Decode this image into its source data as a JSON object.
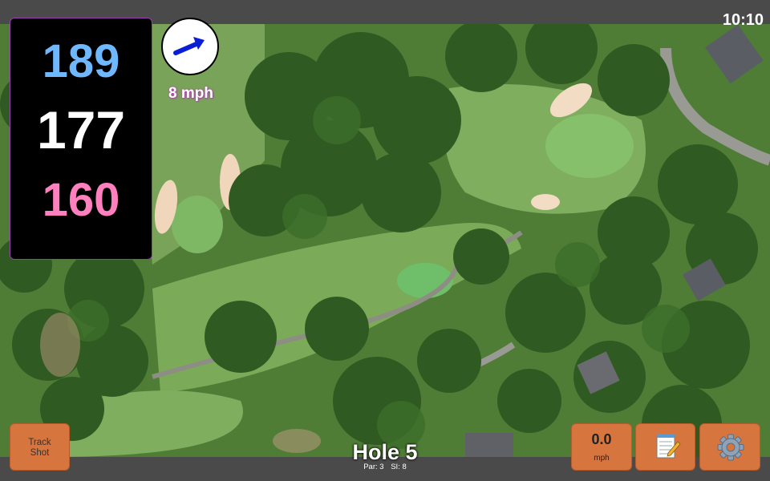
{
  "status": {
    "time": "10:10"
  },
  "yardages": {
    "back": "189",
    "center": "177",
    "front": "160"
  },
  "wind": {
    "speed_label": "8 mph",
    "icon": "arrow-right-icon"
  },
  "hole": {
    "title": "Hole 5",
    "par": "Par: 3",
    "si": "SI: 8"
  },
  "buttons": {
    "track_shot": [
      "Track",
      "Shot"
    ],
    "speed_value": "0.0",
    "speed_unit": "mph",
    "notes_icon": "notepad-icon",
    "settings_icon": "gear-icon"
  },
  "colors": {
    "back_yardage": "#6fb7ff",
    "center_yardage": "#ffffff",
    "front_yardage": "#ff7fbf",
    "button": "#d7753e",
    "wind_arrow": "#0a1ed8"
  }
}
